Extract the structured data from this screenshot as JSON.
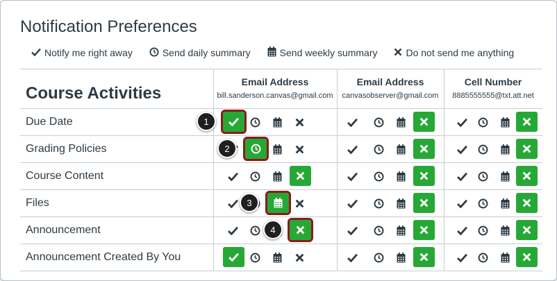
{
  "page_title": "Notification Preferences",
  "legend": {
    "items": [
      {
        "icon": "check-icon",
        "label": "Notify me right away"
      },
      {
        "icon": "clock-icon",
        "label": "Send daily summary"
      },
      {
        "icon": "calendar-icon",
        "label": "Send weekly summary"
      },
      {
        "icon": "x-icon",
        "label": "Do not send me anything"
      }
    ]
  },
  "table": {
    "section_title": "Course Activities",
    "columns": [
      {
        "title": "Email Address",
        "address": "bill.sanderson.canvas@gmail.com"
      },
      {
        "title": "Email Address",
        "address": "canvasobserver@gmail.com"
      },
      {
        "title": "Cell Number",
        "address": "8885555555@txt.att.net"
      }
    ],
    "rows": [
      {
        "label": "Due Date",
        "selected": [
          "immediate",
          "never",
          "never"
        ]
      },
      {
        "label": "Grading Policies",
        "selected": [
          "daily",
          "never",
          "never"
        ]
      },
      {
        "label": "Course Content",
        "selected": [
          "never",
          "never",
          "never"
        ]
      },
      {
        "label": "Files",
        "selected": [
          "weekly",
          "never",
          "never"
        ]
      },
      {
        "label": "Announcement",
        "selected": [
          "never",
          "never",
          "never"
        ]
      },
      {
        "label": "Announcement Created By You",
        "selected": [
          "immediate",
          "never",
          "never"
        ]
      }
    ]
  },
  "callouts": [
    "1",
    "2",
    "3",
    "4"
  ],
  "colors": {
    "selected_green": "#27a836",
    "highlight_border": "#8b1a1a",
    "text": "#2d3b45"
  }
}
